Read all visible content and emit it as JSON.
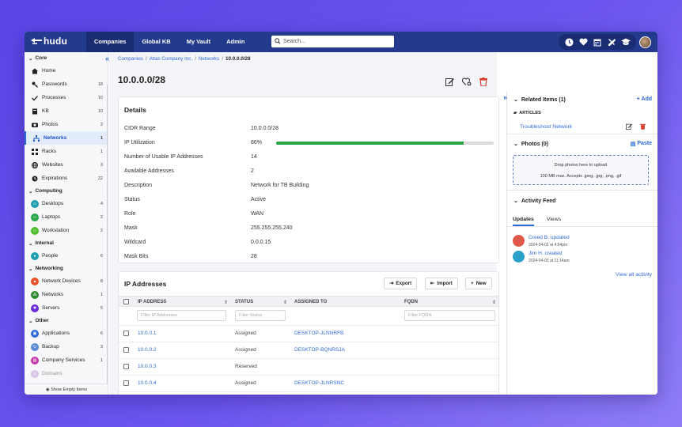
{
  "app": {
    "logo_text": "hudu"
  },
  "topnav": [
    {
      "label": "Companies",
      "active": true
    },
    {
      "label": "Global KB"
    },
    {
      "label": "My Vault"
    },
    {
      "label": "Admin"
    }
  ],
  "search": {
    "placeholder": "Search..."
  },
  "sidebar": {
    "sections": [
      {
        "title": "Core",
        "items": [
          {
            "label": "Home",
            "count": "",
            "icon": "home-icon"
          },
          {
            "label": "Passwords",
            "count": "18",
            "icon": "key-icon"
          },
          {
            "label": "Processes",
            "count": "10",
            "icon": "check-icon"
          },
          {
            "label": "KB",
            "count": "10",
            "icon": "book-icon"
          },
          {
            "label": "Photos",
            "count": "2",
            "icon": "camera-icon"
          },
          {
            "label": "Networks",
            "count": "1",
            "icon": "network-icon",
            "active": true
          },
          {
            "label": "Racks",
            "count": "1",
            "icon": "rack-icon"
          },
          {
            "label": "Websites",
            "count": "3",
            "icon": "globe-icon"
          },
          {
            "label": "Expirations",
            "count": "22",
            "icon": "clock-icon"
          }
        ]
      },
      {
        "title": "Computing",
        "items": [
          {
            "label": "Desktops",
            "count": "4",
            "color": "#1aa0b0"
          },
          {
            "label": "Laptops",
            "count": "2",
            "color": "#27a84a"
          },
          {
            "label": "Workstation",
            "count": "2",
            "color": "#4cbf2a"
          }
        ]
      },
      {
        "title": "Internal",
        "items": [
          {
            "label": "People",
            "count": "6",
            "color": "#1aa0b0"
          }
        ]
      },
      {
        "title": "Networking",
        "items": [
          {
            "label": "Network Devices",
            "count": "8",
            "color": "#e8552a"
          },
          {
            "label": "Networks",
            "count": "1",
            "color": "#2a8a2a"
          },
          {
            "label": "Servers",
            "count": "5",
            "color": "#6a2ad6"
          }
        ]
      },
      {
        "title": "Other",
        "items": [
          {
            "label": "Applications",
            "count": "6",
            "color": "#2d6ad6"
          },
          {
            "label": "Backup",
            "count": "3",
            "color": "#5a8ad6"
          },
          {
            "label": "Company Services",
            "count": "1",
            "color": "#c43aa8"
          },
          {
            "label": "Domains",
            "count": "",
            "color": "#b08ad6"
          }
        ]
      }
    ],
    "show_empty": "Show Empty Items"
  },
  "breadcrumb": [
    "Companies",
    "Atlas Company Inc.",
    "Networks",
    "10.0.0.0/28"
  ],
  "page": {
    "title": "10.0.0.0/28"
  },
  "details": {
    "title": "Details",
    "rows": [
      {
        "key": "CIDR Range",
        "value": "10.0.0.0/28"
      },
      {
        "key": "IP Utilization",
        "value": "86%",
        "progress": 0.86
      },
      {
        "key": "Number of Usable IP Addresses",
        "value": "14"
      },
      {
        "key": "Available Addresses",
        "value": "2"
      },
      {
        "key": "Description",
        "value": "Network for TB Building"
      },
      {
        "key": "Status",
        "value": "Active"
      },
      {
        "key": "Role",
        "value": "WAN"
      },
      {
        "key": "Mask",
        "value": "255.255.255.240"
      },
      {
        "key": "Wildcard",
        "value": "0.0.0.15"
      },
      {
        "key": "Mask Bits",
        "value": "28"
      }
    ]
  },
  "ip_table": {
    "title": "IP Addresses",
    "buttons": {
      "export": "Export",
      "import": "Import",
      "new": "New"
    },
    "columns": [
      "IP ADDRESS",
      "STATUS",
      "ASSIGNED TO",
      "FQDN"
    ],
    "filters": {
      "ip": "Filter IP Addresses",
      "status": "Filter Status",
      "fqdn": "Filter FQDN"
    },
    "rows": [
      {
        "ip": "10.0.0.1",
        "status": "Assigned",
        "assigned": "DESKTOP-JLNNRFB"
      },
      {
        "ip": "10.0.0.2",
        "status": "Assigned",
        "assigned": "DESKTOP-BQNRSJA"
      },
      {
        "ip": "10.0.0.3",
        "status": "Reserved",
        "assigned": ""
      },
      {
        "ip": "10.0.0.4",
        "status": "Assigned",
        "assigned": "DESKTOP-JLNRSNC"
      }
    ]
  },
  "related": {
    "title": "Related Items (1)",
    "add": "+ Add",
    "group": "ARTICLES",
    "item": "Troubleshoot Network"
  },
  "photos": {
    "title": "Photos (0)",
    "paste": "Paste",
    "drop_line1": "Drop photos here to upload",
    "drop_line2": "100 MB max. Accepts .jpeg, .jpg, .png, .gif"
  },
  "activity": {
    "title": "Activity Feed",
    "tabs": [
      "Updates",
      "Views"
    ],
    "entries": [
      {
        "text": "Creed B. updated",
        "time": "2024-04-02 at 4:54pm",
        "color": "#e0584a"
      },
      {
        "text": "Jim H. created",
        "time": "2024-04-02 at 11:14am",
        "color": "#2aa0c8"
      }
    ],
    "view_all": "View all activity"
  }
}
